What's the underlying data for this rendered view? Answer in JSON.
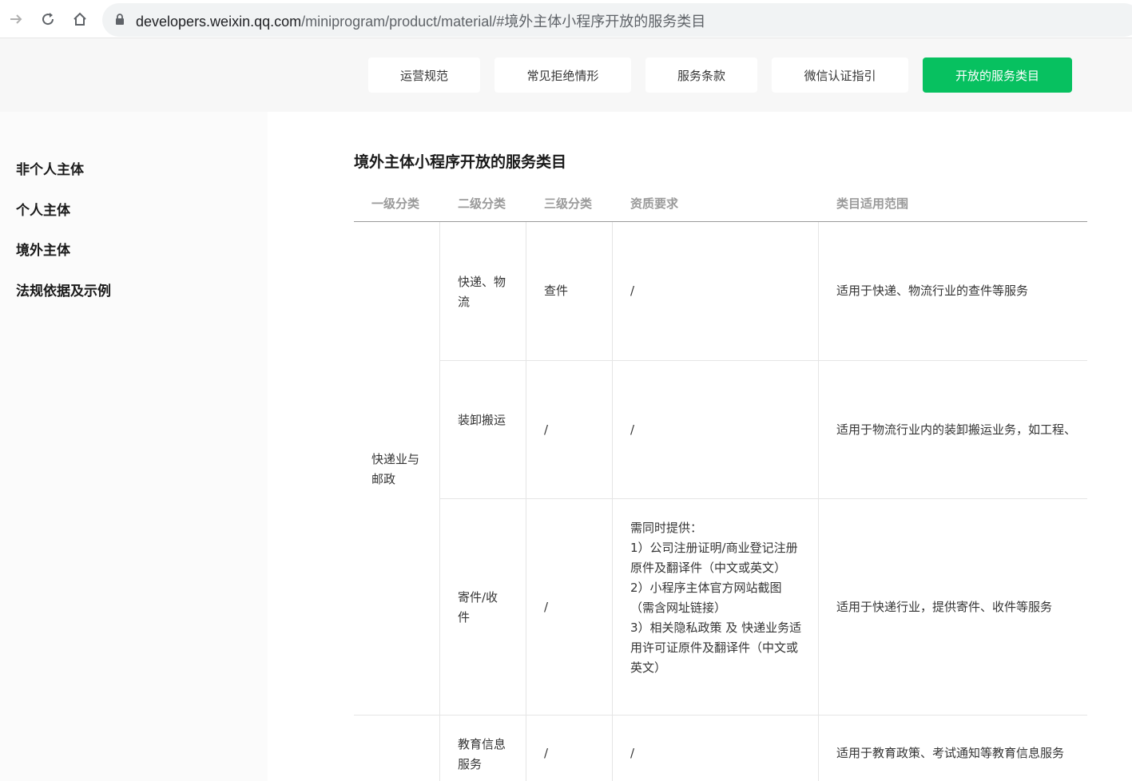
{
  "browser": {
    "url_host": "developers.weixin.qq.com",
    "url_path": "/miniprogram/product/material/#境外主体小程序开放的服务类目"
  },
  "top_tabs": [
    {
      "label": "运营规范",
      "active": false
    },
    {
      "label": "常见拒绝情形",
      "active": false
    },
    {
      "label": "服务条款",
      "active": false
    },
    {
      "label": "微信认证指引",
      "active": false
    },
    {
      "label": "开放的服务类目",
      "active": true
    }
  ],
  "sidebar": {
    "items": [
      {
        "label": "非个人主体"
      },
      {
        "label": "个人主体"
      },
      {
        "label": "境外主体"
      },
      {
        "label": "法规依据及示例"
      }
    ]
  },
  "main": {
    "title": "境外主体小程序开放的服务类目",
    "table": {
      "headers": [
        "一级分类",
        "二级分类",
        "三级分类",
        "资质要求",
        "类目适用范围"
      ],
      "groups": [
        {
          "level1": "快递业与邮政"
        }
      ],
      "rows": [
        {
          "level2": "快递、物流",
          "level3": "查件",
          "requirement": "/",
          "scope": "适用于快递、物流行业的查件等服务"
        },
        {
          "level2": "装卸搬运",
          "level3": "/",
          "requirement": "/",
          "scope": "适用于物流行业内的装卸搬运业务，如工程、"
        },
        {
          "level2": "寄件/收件",
          "level3": "/",
          "requirement": "需同时提供：\n1）公司注册证明/商业登记注册 原件及翻译件（中文或英文）\n2）小程序主体官方网站截图（需含网址链接）\n3）相关隐私政策 及 快递业务适用许可证原件及翻译件（中文或英文）",
          "scope": "适用于快递行业，提供寄件、收件等服务"
        },
        {
          "level2": "教育信息服务",
          "level3": "/",
          "requirement": "/",
          "scope": "适用于教育政策、考试通知等教育信息服务"
        }
      ]
    }
  },
  "colors": {
    "accent": "#07c160"
  }
}
